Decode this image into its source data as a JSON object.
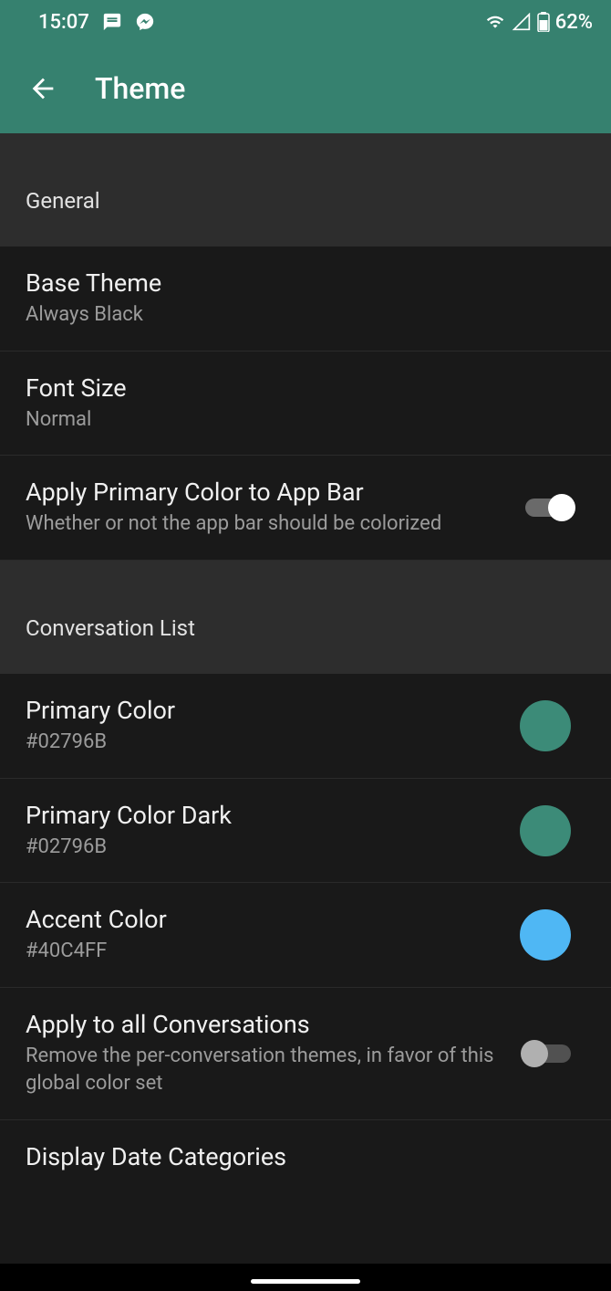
{
  "status": {
    "time": "15:07",
    "battery": "62%"
  },
  "header": {
    "title": "Theme"
  },
  "sections": {
    "general": {
      "label": "General",
      "baseTheme": {
        "title": "Base Theme",
        "value": "Always Black"
      },
      "fontSize": {
        "title": "Font Size",
        "value": "Normal"
      },
      "applyPrimary": {
        "title": "Apply Primary Color to App Bar",
        "sub": "Whether or not the app bar should be colorized"
      }
    },
    "convoList": {
      "label": "Conversation List",
      "primaryColor": {
        "title": "Primary Color",
        "value": "#02796B",
        "swatch": "#3C8B78"
      },
      "primaryColorDark": {
        "title": "Primary Color Dark",
        "value": "#02796B",
        "swatch": "#3C8B78"
      },
      "accentColor": {
        "title": "Accent Color",
        "value": "#40C4FF",
        "swatch": "#4FB7F4"
      },
      "applyAll": {
        "title": "Apply to all Conversations",
        "sub": "Remove the per-conversation themes, in favor of this global color set"
      },
      "displayDate": {
        "title": "Display Date Categories"
      }
    }
  }
}
